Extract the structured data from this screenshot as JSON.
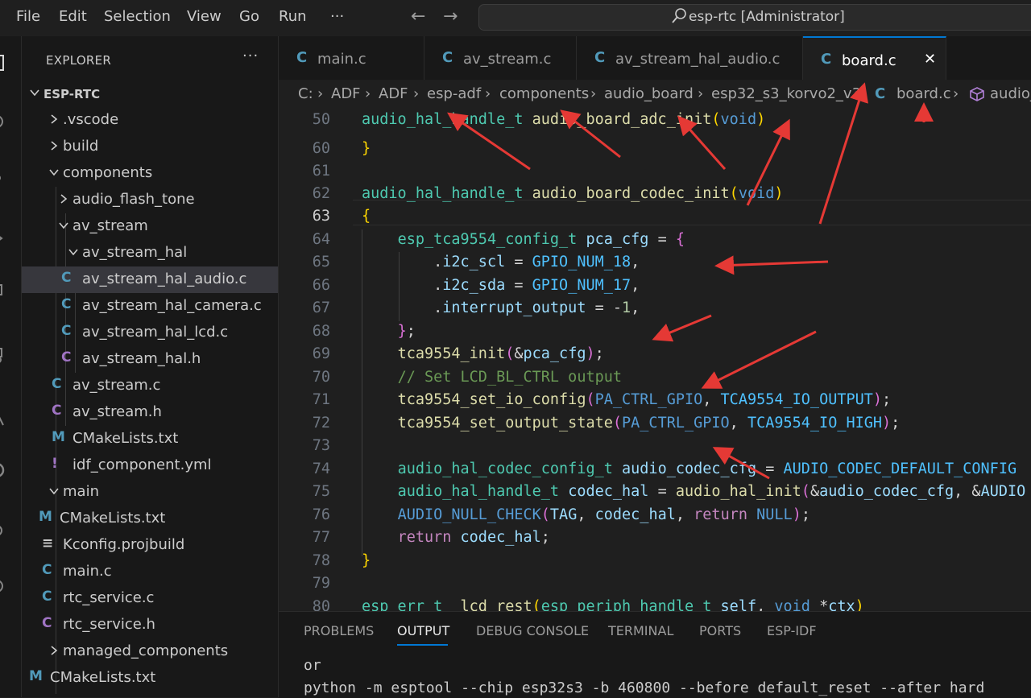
{
  "menu": [
    "File",
    "Edit",
    "Selection",
    "View",
    "Go",
    "Run",
    "···"
  ],
  "search": {
    "text": "esp-rtc [Administrator]"
  },
  "explorer": {
    "title": "EXPLORER",
    "more": "···",
    "tree": [
      {
        "label": "ESP-RTC",
        "type": "root"
      },
      {
        "label": ".vscode",
        "type": "folder"
      },
      {
        "label": "build",
        "type": "folder"
      },
      {
        "label": "components",
        "type": "folder"
      },
      {
        "label": "audio_flash_tone",
        "type": "folder"
      },
      {
        "label": "av_stream",
        "type": "folder"
      },
      {
        "label": "av_stream_hal",
        "type": "folder"
      },
      {
        "label": "av_stream_hal_audio.c",
        "type": "c"
      },
      {
        "label": "av_stream_hal_camera.c",
        "type": "c"
      },
      {
        "label": "av_stream_hal_lcd.c",
        "type": "c"
      },
      {
        "label": "av_stream_hal.h",
        "type": "h"
      },
      {
        "label": "av_stream.c",
        "type": "c"
      },
      {
        "label": "av_stream.h",
        "type": "h"
      },
      {
        "label": "CMakeLists.txt",
        "type": "cmake"
      },
      {
        "label": "idf_component.yml",
        "type": "yml"
      },
      {
        "label": "main",
        "type": "folder"
      },
      {
        "label": "CMakeLists.txt",
        "type": "cmake"
      },
      {
        "label": "Kconfig.projbuild",
        "type": "kconfig"
      },
      {
        "label": "main.c",
        "type": "c"
      },
      {
        "label": "rtc_service.c",
        "type": "c"
      },
      {
        "label": "rtc_service.h",
        "type": "h"
      },
      {
        "label": "managed_components",
        "type": "folder"
      },
      {
        "label": "CMakeLists.txt",
        "type": "cmake"
      }
    ]
  },
  "tabs": [
    {
      "label": "main.c",
      "icon": "C"
    },
    {
      "label": "av_stream.c",
      "icon": "C"
    },
    {
      "label": "av_stream_hal_audio.c",
      "icon": "C"
    },
    {
      "label": "board.c",
      "icon": "C",
      "close": "✕"
    }
  ],
  "breadcrumb": [
    "C:",
    "ADF",
    "ADF",
    "esp-adf",
    "components",
    "audio_board",
    "esp32_s3_korvo2_v3",
    "board.c",
    "audio_"
  ],
  "editor": {
    "line_numbers": [
      "50",
      "60",
      "61",
      "62",
      "63",
      "64",
      "65",
      "66",
      "67",
      "68",
      "69",
      "70",
      "71",
      "72",
      "73",
      "74",
      "75",
      "76",
      "77",
      "78",
      "79",
      "80"
    ],
    "current_line": "63"
  },
  "panel": {
    "tabs": [
      "PROBLEMS",
      "OUTPUT",
      "DEBUG CONSOLE",
      "TERMINAL",
      "PORTS",
      "ESP-IDF"
    ],
    "active_tab": "OUTPUT",
    "lines": [
      "or",
      "python -m esptool --chip esp32s3 -b 460800 --before default_reset --after hard"
    ]
  },
  "colors": {
    "accent": "#0078d4",
    "annotation": "#e53935",
    "c_icon": "#519aba",
    "h_icon": "#a074c4"
  }
}
